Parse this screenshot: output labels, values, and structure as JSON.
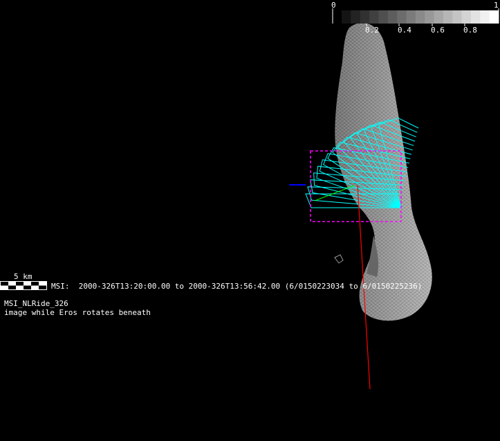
{
  "colorbar": {
    "min_label": "0",
    "max_label": "1",
    "ticks": [
      "0.2",
      "0.4",
      "0.6",
      "0.8"
    ],
    "steps": 17
  },
  "scale_bar": {
    "label": "5 km"
  },
  "info": {
    "time_range": "MSI:  2000-326T13:20:00.00 to 2000-326T13:56:42.00 (6/0150223034 to 6/0150225236)",
    "title": "MSI_NLRide_326",
    "description": "image while Eros rotates beneath"
  },
  "colors": {
    "footprint": "#00ffff",
    "boresight": "#ff0000",
    "selection": "#ff00ff",
    "axis_x": "#0000ff",
    "axis_y": "#00ff00"
  }
}
